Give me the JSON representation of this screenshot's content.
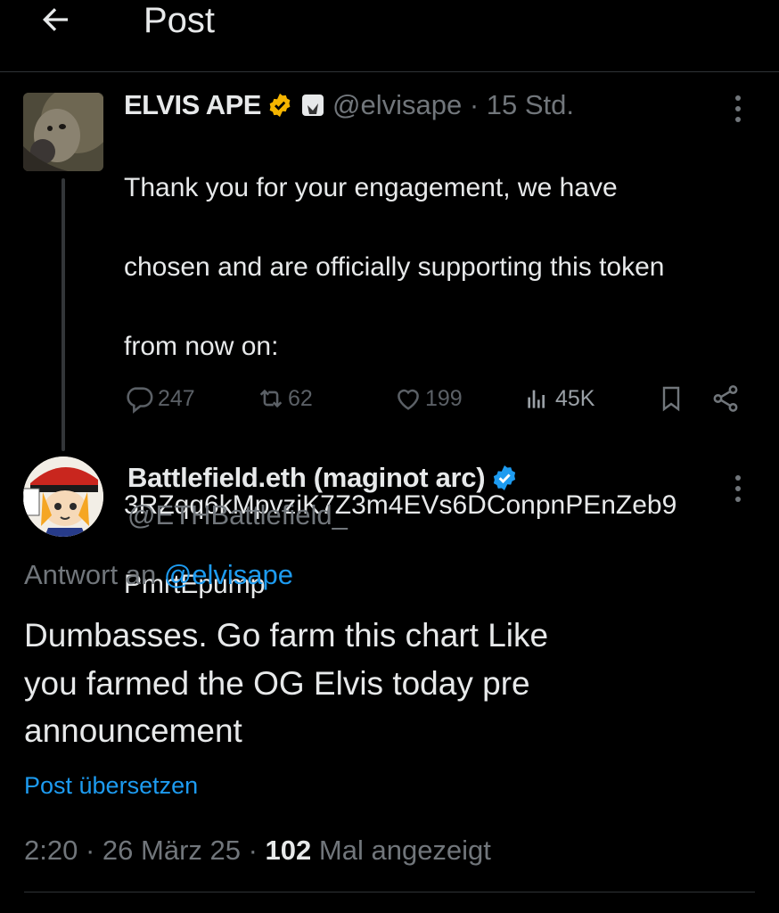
{
  "header": {
    "title": "Post"
  },
  "tweet1": {
    "name": "ELVIS APE",
    "handle": "@elvisape",
    "separator": " · ",
    "time": "15 Std.",
    "text_lines": [
      "Thank you for your engagement, we have",
      "chosen and are officially supporting this token",
      "from now on:",
      "",
      "3RZqq6kMpvziK7Z3m4EVs6DConpnPEnZeb9",
      "PmrtEpump"
    ],
    "actions": {
      "replies": "247",
      "reposts": "62",
      "likes": "199",
      "views": "45K"
    }
  },
  "tweet2": {
    "name": "Battlefield.eth (maginot arc)",
    "handle": "@ETHBattlefield_",
    "reply_prefix": "Antwort an ",
    "reply_handle": "@elvisape",
    "body_lines": [
      "Dumbasses. Go farm this chart Like",
      "you farmed the OG Elvis today pre",
      "announcement"
    ],
    "translate": "Post übersetzen",
    "time": "2:20",
    "date": "26 März 25",
    "views_count": "102",
    "views_label": "Mal angezeigt"
  },
  "colors": {
    "background": "#000000",
    "text": "#e7e9ea",
    "muted": "#71767b",
    "link": "#1d9bf0",
    "gold": "#f4b400"
  }
}
